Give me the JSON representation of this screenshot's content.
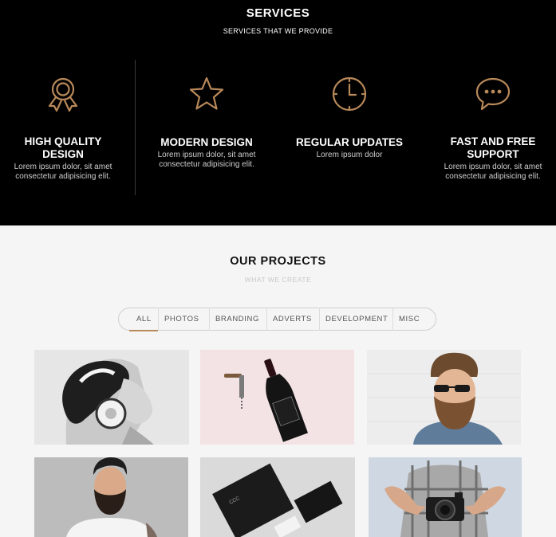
{
  "services": {
    "title": "SERVICES",
    "subtitle": "SERVICES THAT WE PROVIDE",
    "accent_color": "#b8895a",
    "items": [
      {
        "icon": "award-ribbon-icon",
        "title_line1": "HIGH QUALITY",
        "title_line2": "DESIGN",
        "text_line1": "Lorem ipsum dolor, sit amet",
        "text_line2": "consectetur adipisicing elit."
      },
      {
        "icon": "star-icon",
        "title_line1": "MODERN DESIGN",
        "title_line2": "",
        "text_line1": "Lorem ipsum dolor, sit amet",
        "text_line2": "consectetur adipisicing elit."
      },
      {
        "icon": "clock-icon",
        "title_line1": "REGULAR UPDATES",
        "title_line2": "",
        "text_line1": "Lorem ipsum dolor",
        "text_line2": ""
      },
      {
        "icon": "chat-bubble-icon",
        "title_line1": "FAST AND FREE",
        "title_line2": "SUPPORT",
        "text_line1": "Lorem ipsum dolor, sit amet",
        "text_line2": "consectetur adipisicing elit."
      }
    ]
  },
  "projects": {
    "title": "OUR PROJECTS",
    "subtitle": "WHAT WE CREATE",
    "filters": [
      "ALL",
      "PHOTOS",
      "BRANDING",
      "ADVERTS",
      "DEVELOPMENT",
      "MISC"
    ],
    "active_filter": "ALL",
    "thumbnails": [
      "woman-headphones-photo",
      "wine-bottle-corkscrew-photo",
      "bearded-man-sunglasses-photo",
      "bearded-man-tattoo-photo",
      "stationery-mockup-photo",
      "photographer-camera-photo"
    ]
  }
}
